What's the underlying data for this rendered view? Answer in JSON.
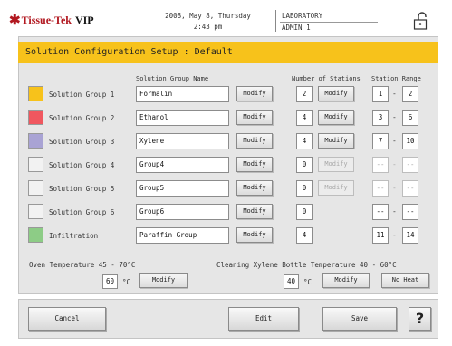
{
  "header": {
    "logo_text": "Tissue-Tek",
    "logo_suffix": "VIP",
    "date": "2008, May 8, Thursday",
    "time": "2:43 pm",
    "location": "LABORATORY",
    "user": "ADMIN 1",
    "lock_icon": "padlock-icon"
  },
  "title": "Solution Configuration Setup : Default",
  "columns": {
    "group_name": "Solution Group Name",
    "stations": "Number of Stations",
    "range": "Station Range"
  },
  "colors": {
    "title_bar": "#f7c21b",
    "group1": "#f7c21b",
    "group2": "#f0575f",
    "group3": "#a9a3d4",
    "infiltration": "#8dcc86",
    "empty_swatch": "#f2f2f2"
  },
  "groups": [
    {
      "label": "Solution Group 1",
      "name": "Formalin",
      "modify": "Modify",
      "stations": "2",
      "stations_modify": "Modify",
      "range_start": "1",
      "range_end": "2",
      "dash": "-"
    },
    {
      "label": "Solution Group 2",
      "name": "Ethanol",
      "modify": "Modify",
      "stations": "4",
      "stations_modify": "Modify",
      "range_start": "3",
      "range_end": "6",
      "dash": "-"
    },
    {
      "label": "Solution Group 3",
      "name": "Xylene",
      "modify": "Modify",
      "stations": "4",
      "stations_modify": "Modify",
      "range_start": "7",
      "range_end": "10",
      "dash": "-"
    },
    {
      "label": "Solution Group 4",
      "name": "Group4",
      "modify": "Modify",
      "stations": "0",
      "stations_modify": "Modify",
      "range_start": "--",
      "range_end": "--",
      "dash": "-"
    },
    {
      "label": "Solution Group 5",
      "name": "Group5",
      "modify": "Modify",
      "stations": "0",
      "stations_modify": "Modify",
      "range_start": "--",
      "range_end": "--",
      "dash": "-"
    },
    {
      "label": "Solution Group 6",
      "name": "Group6",
      "modify": "Modify",
      "stations": "0",
      "range_start": "--",
      "range_end": "--",
      "dash": "-"
    },
    {
      "label": "Infiltration",
      "name": "Paraffin Group",
      "modify": "Modify",
      "stations": "4",
      "range_start": "11",
      "range_end": "14",
      "dash": "-"
    }
  ],
  "oven": {
    "label": "Oven Temperature  45 - 70°C",
    "value": "60",
    "unit": "°C",
    "modify": "Modify"
  },
  "xylene": {
    "label": "Cleaning Xylene Bottle Temperature  40 - 60°C",
    "value": "40",
    "unit": "°C",
    "modify": "Modify",
    "no_heat": "No Heat"
  },
  "footer": {
    "cancel": "Cancel",
    "edit": "Edit",
    "save": "Save",
    "help": "?"
  }
}
